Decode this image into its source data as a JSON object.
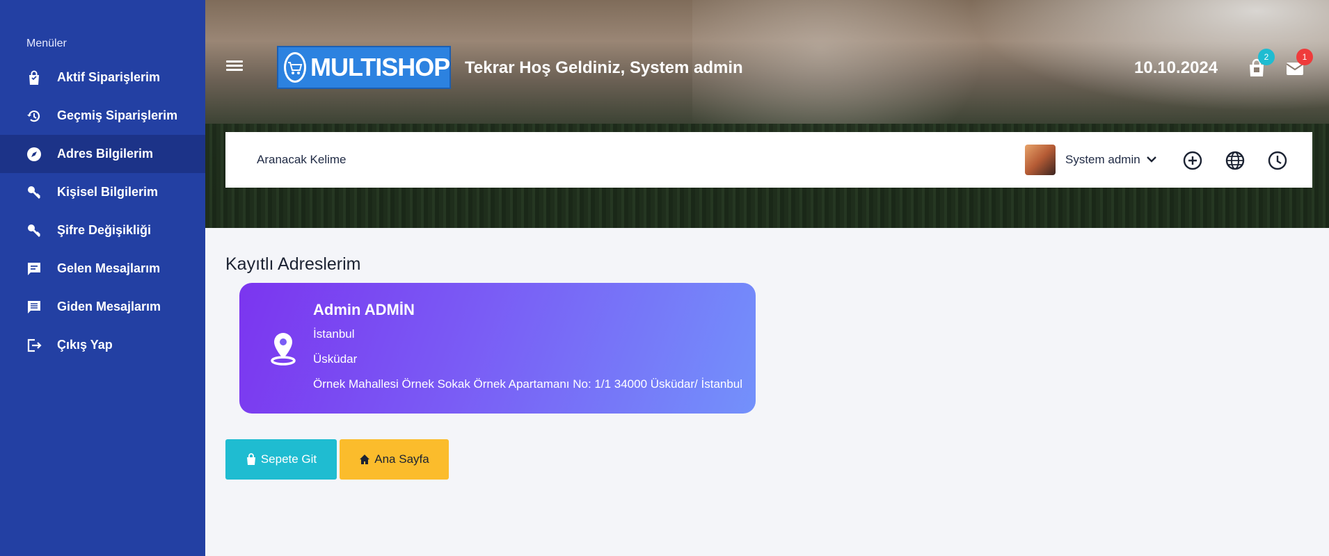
{
  "sidebar": {
    "title": "Menüler",
    "items": [
      {
        "label": "Aktif Siparişlerim",
        "icon": "shopping-bag-icon"
      },
      {
        "label": "Geçmiş Siparişlerim",
        "icon": "history-icon"
      },
      {
        "label": "Adres Bilgilerim",
        "icon": "compass-icon"
      },
      {
        "label": "Kişisel Bilgilerim",
        "icon": "key-icon"
      },
      {
        "label": "Şifre Değişikliği",
        "icon": "key-icon"
      },
      {
        "label": "Gelen Mesajlarım",
        "icon": "message-icon"
      },
      {
        "label": "Giden Mesajlarım",
        "icon": "message-lines-icon"
      },
      {
        "label": "Çıkış Yap",
        "icon": "logout-icon"
      }
    ],
    "active_index": 2
  },
  "header": {
    "logo_text": "MULTISHOP",
    "welcome": "Tekrar Hoş Geldiniz, System admin",
    "date": "10.10.2024",
    "cart_count": "2",
    "mail_count": "1"
  },
  "searchbar": {
    "search_label": "Aranacak Kelime",
    "user_name": "System admin"
  },
  "main": {
    "section_title": "Kayıtlı Adreslerim",
    "address": {
      "name": "Admin ADMİN",
      "city": "İstanbul",
      "district": "Üsküdar",
      "full": "Örnek Mahallesi Örnek Sokak Örnek Apartamanı No: 1/1 34000 Üsküdar/ İstanbul"
    },
    "buttons": {
      "cart": "Sepete Git",
      "home": "Ana Sayfa"
    }
  },
  "colors": {
    "sidebar": "#2340a3",
    "sidebar_active": "#1c3388",
    "card_gradient_start": "#7b35ef",
    "card_gradient_end": "#7391fb",
    "btn_cart": "#1fbcd1",
    "btn_home": "#fbbc2c",
    "badge_cart": "#1fbcd1",
    "badge_mail": "#ef3b3b"
  }
}
